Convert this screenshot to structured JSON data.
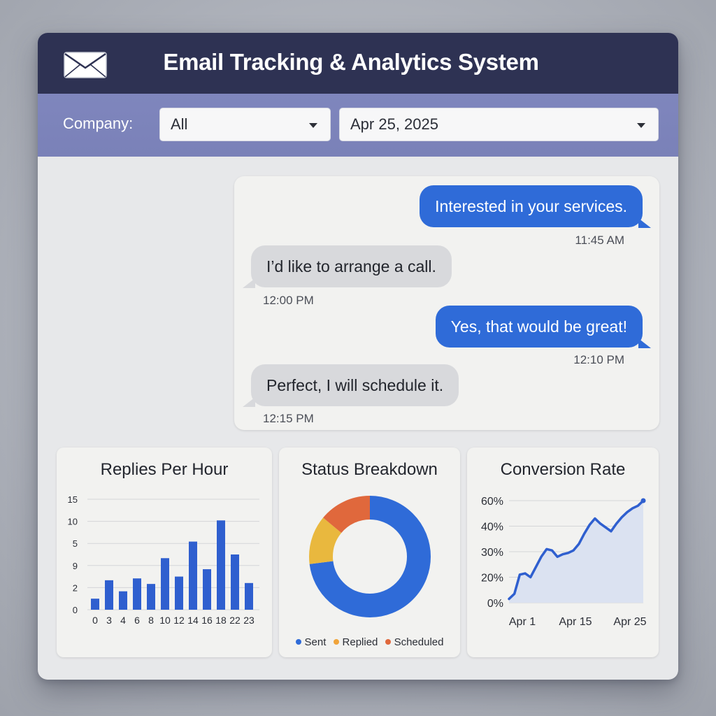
{
  "window": {
    "title": "Email Tracking & Analytics System",
    "icon": "envelope-icon"
  },
  "filters": {
    "company_label": "Company:",
    "company_value": "All",
    "date_value": "Apr 25, 2025"
  },
  "messages": [
    {
      "direction": "outgoing",
      "text": "Interested in your services.",
      "time": "11:45 AM"
    },
    {
      "direction": "incoming",
      "text": "I’d like to arrange a call.",
      "time": "12:00 PM"
    },
    {
      "direction": "outgoing",
      "text": "Yes, that would be great!",
      "time": "12:10 PM"
    },
    {
      "direction": "incoming",
      "text": "Perfect, I will schedule it.",
      "time": "12:15 PM"
    }
  ],
  "colors": {
    "titlebar": "#2e3253",
    "filterbar": "#7f86bd",
    "accent_blue": "#2f6bd8",
    "replied_orange": "#f0a43a",
    "scheduled_red": "#e0683c"
  },
  "chart_data": [
    {
      "type": "bar",
      "title": "Replies Per Hour",
      "categories": [
        "0",
        "3",
        "4",
        "6",
        "8",
        "10",
        "12",
        "14",
        "16",
        "18",
        "22",
        "23"
      ],
      "y_tick_labels": [
        "0",
        "2",
        "9",
        "5",
        "10",
        "15"
      ],
      "values": [
        1.2,
        3.2,
        2.0,
        3.4,
        2.8,
        5.6,
        3.6,
        7.4,
        4.4,
        9.7,
        6.0,
        2.9
      ],
      "ylim": [
        0,
        12
      ],
      "grid": true,
      "color": "#2f5fcf"
    },
    {
      "type": "pie",
      "title": "Status Breakdown",
      "donut": true,
      "labels": [
        "Sent",
        "Replied",
        "Scheduled"
      ],
      "values": [
        73,
        13,
        14
      ],
      "colors": [
        "#2f6bd8",
        "#e9b83e",
        "#e0683c"
      ],
      "legend_colors": [
        "#2f6bd8",
        "#f0a43a",
        "#e0683c"
      ],
      "legend": "bottom"
    },
    {
      "type": "area",
      "title": "Conversion Rate",
      "y_tick_labels": [
        "0%",
        "20%",
        "30%",
        "40%",
        "60%"
      ],
      "x_tick_labels": [
        "Apr 1",
        "Apr 15",
        "Apr 25"
      ],
      "values": [
        1.5,
        3.5,
        11,
        11.5,
        10,
        14,
        18,
        21,
        20.5,
        18,
        19,
        19.5,
        20.5,
        23,
        27,
        30.5,
        33,
        31,
        29.5,
        28,
        31,
        33.5,
        35.5,
        37,
        38,
        40
      ],
      "ylim": [
        0,
        40
      ],
      "grid": true,
      "line_color": "#2f5fcf",
      "fill_color": "#dbe2f1"
    }
  ]
}
